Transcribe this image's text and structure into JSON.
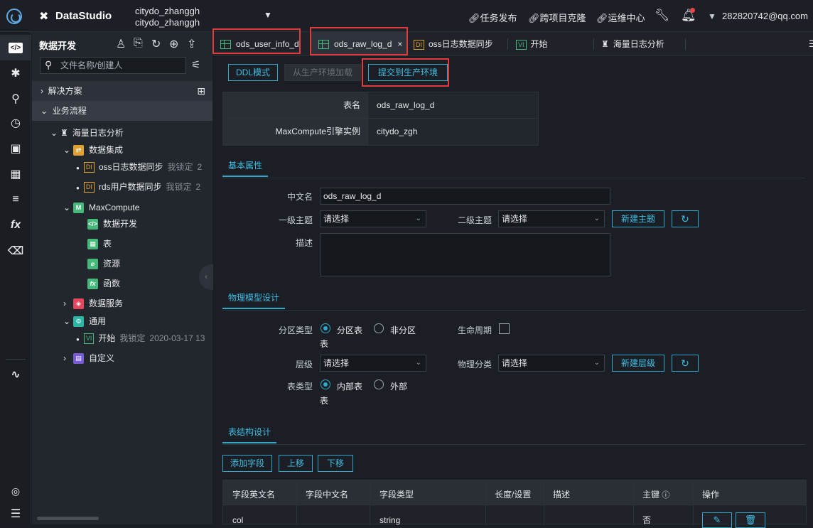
{
  "topbar": {
    "brand": "DataStudio",
    "project_line1": "citydo_zhanggh",
    "project_line2": "citydo_zhanggh",
    "nav": [
      "任务发布",
      "跨项目克隆",
      "运维中心"
    ],
    "user": "282820742@qq.com"
  },
  "iconbar": {
    "items": [
      "code-icon",
      "puzzle-icon",
      "search-icon",
      "clock-icon",
      "briefcase-icon",
      "table-icon",
      "list-icon",
      "function-icon",
      "trash-icon",
      "graph-icon",
      "settings-icon",
      "menu-icon"
    ],
    "fx_label": "fx"
  },
  "sidebar": {
    "title": "数据开发",
    "search_placeholder": "文件名称/创建人",
    "sections": [
      "解决方案",
      "业务流程"
    ],
    "tree": {
      "root": "海量日志分析",
      "data_integration": "数据集成",
      "item1": "oss日志数据同步",
      "item2": "rds用户数据同步",
      "locked": "我锁定",
      "locked_suffix": "2",
      "maxcompute": "MaxCompute",
      "mc_children": [
        "数据开发",
        "表",
        "资源",
        "函数"
      ],
      "data_service": "数据服务",
      "general": "通用",
      "start": "开始",
      "start_date": "2020-03-17 13",
      "custom": "自定义",
      "badge_di": "DI",
      "badge_vi": "VI"
    }
  },
  "tabs": [
    {
      "label": "ods_user_info_d"
    },
    {
      "label": "ods_raw_log_d",
      "close": "×"
    },
    {
      "label": "oss日志数据同步",
      "badge": "DI"
    },
    {
      "label": "开始",
      "badge": "VI"
    },
    {
      "label": "海量日志分析"
    }
  ],
  "toolbar": {
    "ddl": "DDL模式",
    "load": "从生产环境加载",
    "submit": "提交到生产环境"
  },
  "info": {
    "table_name_label": "表名",
    "table_name": "ods_raw_log_d",
    "instance_label": "MaxCompute引擎实例",
    "instance": "citydo_zgh"
  },
  "basic": {
    "section": "基本属性",
    "cn_name_label": "中文名",
    "cn_name": "ods_raw_log_d",
    "topic1_label": "一级主题",
    "topic2_label": "二级主题",
    "placeholder": "请选择",
    "new_topic": "新建主题",
    "desc_label": "描述"
  },
  "physical": {
    "section": "物理模型设计",
    "partition_label": "分区类型",
    "partition_on": "分区表",
    "partition_off": "非分区",
    "partition_wrap": "表",
    "lifecycle_label": "生命周期",
    "layer_label": "层级",
    "category_label": "物理分类",
    "new_layer": "新建层级",
    "type_label": "表类型",
    "internal": "内部表",
    "external": "外部",
    "type_wrap": "表"
  },
  "structure": {
    "section": "表结构设计",
    "add": "添加字段",
    "up": "上移",
    "down": "下移",
    "columns": [
      "字段英文名",
      "字段中文名",
      "字段类型",
      "长度/设置",
      "描述",
      "主键",
      "操作"
    ],
    "rows": [
      {
        "en": "col",
        "type": "string",
        "pk": "否"
      }
    ]
  }
}
